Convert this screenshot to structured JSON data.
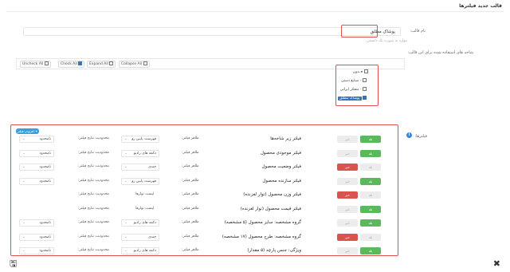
{
  "page": {
    "title": "قالب جدید فیلترها"
  },
  "form": {
    "name_label": "نام قالب:",
    "name_value": "پوشاک مطلق",
    "name_hint": "موارد به صورت یک دانستن",
    "branches_label": "شاخه های استفاده شده برای این قالب:"
  },
  "toolbar": {
    "uncheck_all": "Uncheck All",
    "check_all": "Check All",
    "expand_all": "Expand All",
    "collapse_all": "Collapse All"
  },
  "tree": {
    "root": "بدون",
    "items": [
      {
        "label": "- صنایع دستی",
        "checked": false
      },
      {
        "label": "- متفکر ایرانی",
        "checked": false
      },
      {
        "label": "پوشاک مطلق",
        "checked": true
      }
    ]
  },
  "filters_section": {
    "label": "فیلترها:",
    "add_tag": "افزودن فیلتر +"
  },
  "toggle_labels": {
    "on": "بله",
    "off": "خیر"
  },
  "cell_labels": {
    "display_type": "ظاهر فیلتر:",
    "limit": "محدودیت نتایج فیلتر:"
  },
  "filters": [
    {
      "name": "فیلتر زیر شاخه‌ها",
      "state": "green",
      "display": "فهرست پایین رو",
      "display_type": "select",
      "limit": "نامحدود"
    },
    {
      "name": "فیلتر موجودی محصول",
      "state": "green",
      "display": "دکمه های رادیو",
      "display_type": "select",
      "limit": "نامحدود"
    },
    {
      "name": "فیلتر وضعیت محصول",
      "state": "red",
      "display": "چندی",
      "display_type": "select",
      "limit": "نامحدود"
    },
    {
      "name": "فیلتر سازنده محصول",
      "state": "green",
      "display": "فهرست پایین رو",
      "display_type": "select",
      "limit": "نامحدود"
    },
    {
      "name": "فیلتر وزن محصول (نوار لغزنده)",
      "state": "red",
      "display": "لیست نوارها",
      "display_type": "text",
      "limit": ""
    },
    {
      "name": "فیلتر قیمت محصول (نوار لغزنده)",
      "state": "green",
      "display": "لیست نوارها",
      "display_type": "text",
      "limit": ""
    },
    {
      "name": "گروه مشخصه: سایز محصول (۵ مشخصه)",
      "state": "green",
      "display": "دکمه های رادیو",
      "display_type": "select",
      "limit": "نامحدود"
    },
    {
      "name": "گروه مشخصه: طرح محصول (۱۷ مشخصه)",
      "state": "red",
      "display": "چندی",
      "display_type": "select",
      "limit": "نامحدود"
    },
    {
      "name": "ویژگی: جنس پارچه (۵ مقدار)",
      "state": "green",
      "display": "دکمه های رادیو",
      "display_type": "select",
      "limit": "نامحدود"
    }
  ],
  "footer": {
    "save_icon": "floppy-icon",
    "close_icon": "close-icon"
  }
}
